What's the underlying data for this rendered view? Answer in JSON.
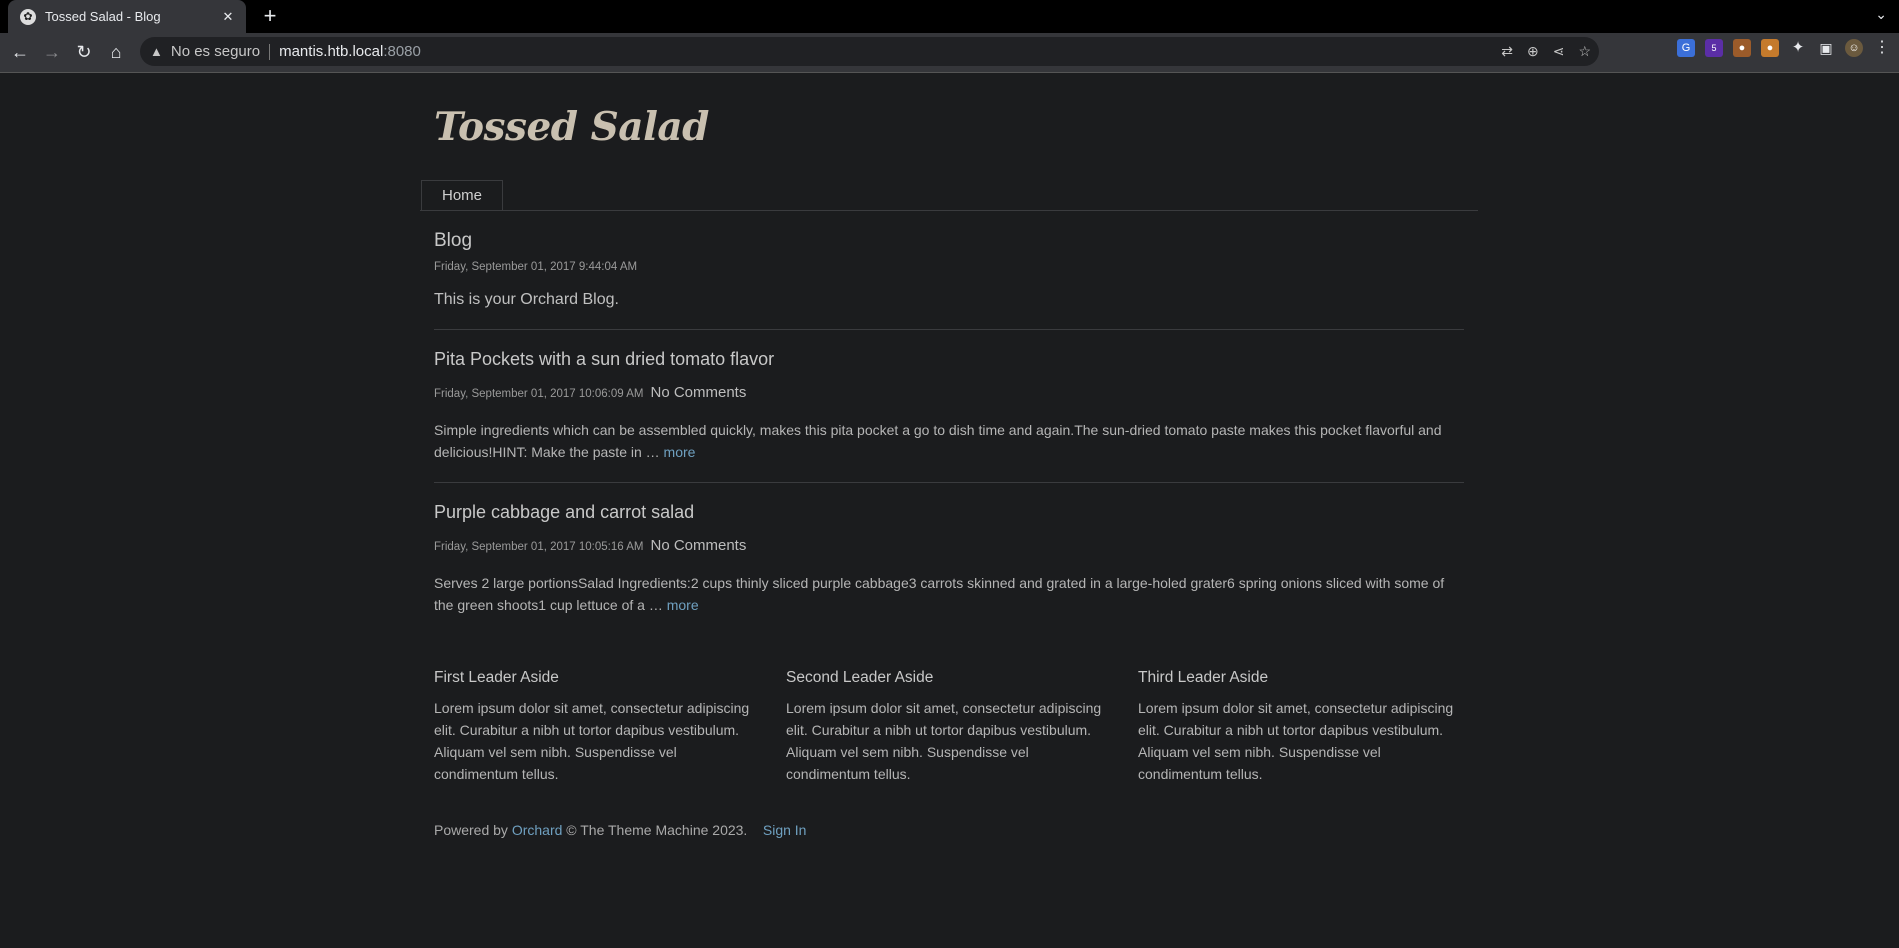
{
  "browser": {
    "tab_title": "Tossed Salad - Blog",
    "security_label": "No es seguro",
    "url_host": "mantis.htb.local",
    "url_port": ":8080",
    "extension_badge": "5"
  },
  "site": {
    "title": "Tossed Salad",
    "nav_home": "Home"
  },
  "blog": {
    "heading": "Blog",
    "date": "Friday, September 01, 2017 9:44:04 AM",
    "description": "This is your Orchard Blog."
  },
  "posts": [
    {
      "title": "Pita Pockets with a sun dried tomato flavor",
      "date": "Friday, September 01, 2017 10:06:09 AM",
      "comments": "No Comments",
      "excerpt": "Simple ingredients which can be assembled quickly, makes this pita pocket a go to dish time and again.The sun-dried tomato paste makes this pocket flavorful and delicious!HINT:  Make the paste in … ",
      "more": "more"
    },
    {
      "title": "Purple cabbage and carrot salad",
      "date": "Friday, September 01, 2017 10:05:16 AM",
      "comments": "No Comments",
      "excerpt": "Serves 2 large portionsSalad Ingredients:2 cups thinly sliced purple cabbage3 carrots skinned and grated in a large-holed grater6 spring onions sliced with some of the green shoots1 cup lettuce of a … ",
      "more": "more"
    }
  ],
  "asides": [
    {
      "title": "First Leader Aside",
      "text": "Lorem ipsum dolor sit amet, consectetur adipiscing elit. Curabitur a nibh ut tortor dapibus vestibulum. Aliquam vel sem nibh. Suspendisse vel condimentum tellus."
    },
    {
      "title": "Second Leader Aside",
      "text": "Lorem ipsum dolor sit amet, consectetur adipiscing elit. Curabitur a nibh ut tortor dapibus vestibulum. Aliquam vel sem nibh. Suspendisse vel condimentum tellus."
    },
    {
      "title": "Third Leader Aside",
      "text": "Lorem ipsum dolor sit amet, consectetur adipiscing elit. Curabitur a nibh ut tortor dapibus vestibulum. Aliquam vel sem nibh. Suspendisse vel condimentum tellus."
    }
  ],
  "footer": {
    "powered_by": "Powered by ",
    "orchard_link": "Orchard",
    "copyright": " © The Theme Machine 2023.",
    "sign_in": "Sign In"
  },
  "colors": {
    "background": "#1b1c1e",
    "link": "#6fa0c0",
    "title": "#c9c0b0"
  },
  "icons": [
    "orchard-favicon-icon",
    "close-icon",
    "plus-icon",
    "chevron-down-icon",
    "back-icon",
    "forward-icon",
    "reload-icon",
    "home-icon",
    "warning-icon",
    "translate-icon",
    "zoom-icon",
    "share-icon",
    "star-icon",
    "extensions-icon",
    "sidepanel-icon",
    "profile-avatar",
    "menu-icon"
  ]
}
